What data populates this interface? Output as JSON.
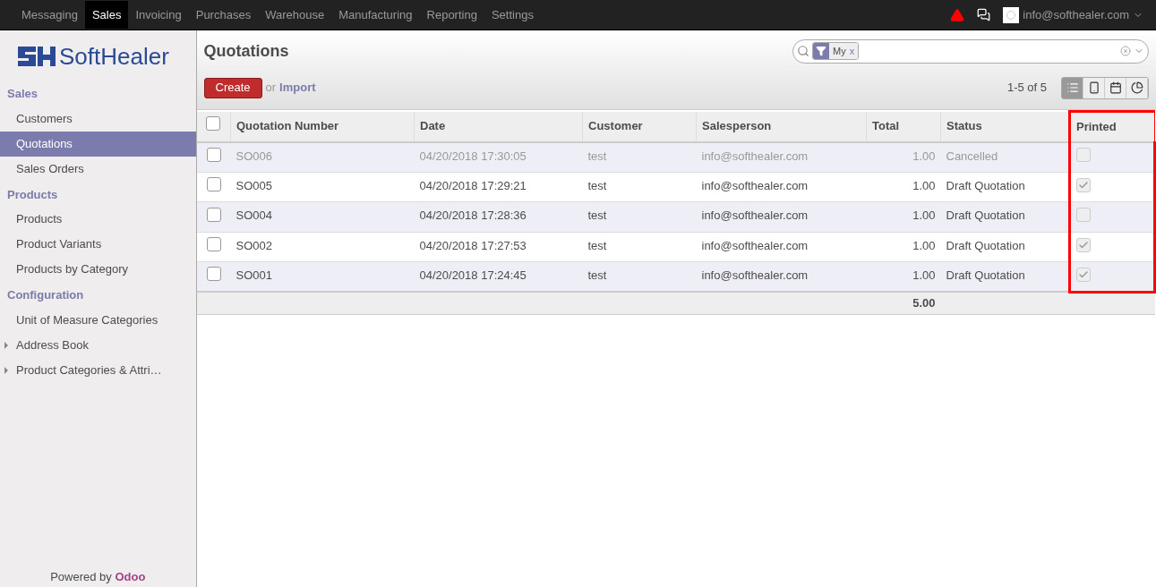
{
  "topbar": {
    "menu": [
      {
        "label": "Messaging",
        "selected": false
      },
      {
        "label": "Sales",
        "selected": true
      },
      {
        "label": "Invoicing",
        "selected": false
      },
      {
        "label": "Purchases",
        "selected": false
      },
      {
        "label": "Warehouse",
        "selected": false
      },
      {
        "label": "Manufacturing",
        "selected": false
      },
      {
        "label": "Reporting",
        "selected": false
      },
      {
        "label": "Settings",
        "selected": false
      }
    ],
    "user": "info@softhealer.com"
  },
  "sidebar": {
    "logo": "SoftHealer",
    "sections": [
      {
        "title": "Sales",
        "items": [
          {
            "label": "Customers",
            "selected": false,
            "kind": "link"
          },
          {
            "label": "Quotations",
            "selected": true,
            "kind": "link"
          },
          {
            "label": "Sales Orders",
            "selected": false,
            "kind": "link"
          }
        ]
      },
      {
        "title": "Products",
        "items": [
          {
            "label": "Products",
            "selected": false,
            "kind": "link"
          },
          {
            "label": "Product Variants",
            "selected": false,
            "kind": "link"
          },
          {
            "label": "Products by Category",
            "selected": false,
            "kind": "link"
          }
        ]
      },
      {
        "title": "Configuration",
        "items": [
          {
            "label": "Unit of Measure Categories",
            "selected": false,
            "kind": "link"
          },
          {
            "label": "Address Book",
            "selected": false,
            "kind": "folder"
          },
          {
            "label": "Product Categories & Attri…",
            "selected": false,
            "kind": "folder"
          }
        ]
      }
    ],
    "footer": {
      "text": "Powered by",
      "brand": "Odoo"
    }
  },
  "main": {
    "title": "Quotations",
    "search": {
      "facet": "My",
      "remove": "x"
    },
    "create": "Create",
    "or": "or",
    "import": "Import",
    "pager": "1-5 of 5",
    "views": [
      {
        "kind": "list",
        "selected": true
      },
      {
        "kind": "form",
        "selected": false
      },
      {
        "kind": "calendar",
        "selected": false
      },
      {
        "kind": "graph",
        "selected": false
      }
    ],
    "table": {
      "all_selected": false,
      "columns": [
        {
          "label": "Quotation Number",
          "highlighted": false
        },
        {
          "label": "Date",
          "highlighted": false
        },
        {
          "label": "Customer",
          "highlighted": false
        },
        {
          "label": "Salesperson",
          "highlighted": false
        },
        {
          "label": "Total",
          "highlighted": false
        },
        {
          "label": "Status",
          "highlighted": false
        },
        {
          "label": "Printed",
          "highlighted": true
        }
      ],
      "rows": [
        {
          "number": "SO006",
          "date": "04/20/2018 17:30:05",
          "customer": "test",
          "salesperson": "info@softhealer.com",
          "total": "1.00",
          "status": "Cancelled",
          "cancelled": true,
          "selected": false,
          "printed": false
        },
        {
          "number": "SO005",
          "date": "04/20/2018 17:29:21",
          "customer": "test",
          "salesperson": "info@softhealer.com",
          "total": "1.00",
          "status": "Draft Quotation",
          "cancelled": false,
          "selected": false,
          "printed": true
        },
        {
          "number": "SO004",
          "date": "04/20/2018 17:28:36",
          "customer": "test",
          "salesperson": "info@softhealer.com",
          "total": "1.00",
          "status": "Draft Quotation",
          "cancelled": false,
          "selected": false,
          "printed": false
        },
        {
          "number": "SO002",
          "date": "04/20/2018 17:27:53",
          "customer": "test",
          "salesperson": "info@softhealer.com",
          "total": "1.00",
          "status": "Draft Quotation",
          "cancelled": false,
          "selected": false,
          "printed": true
        },
        {
          "number": "SO001",
          "date": "04/20/2018 17:24:45",
          "customer": "test",
          "salesperson": "info@softhealer.com",
          "total": "1.00",
          "status": "Draft Quotation",
          "cancelled": false,
          "selected": false,
          "printed": true
        }
      ],
      "sum": "5.00"
    }
  }
}
